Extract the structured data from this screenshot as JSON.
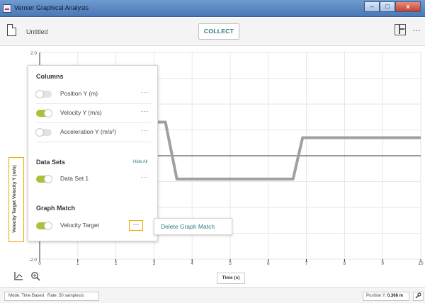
{
  "window": {
    "title": "Vernier Graphical Analysis",
    "minimize": "–",
    "maximize": "□",
    "close": "x"
  },
  "toolbar": {
    "document_name": "Untitled",
    "collect_label": "COLLECT",
    "more_icon": "⋯"
  },
  "graph": {
    "y_axis_label": "Velocity Target  Velocity Y (m/s)",
    "x_axis_label": "Time (s)",
    "y_tick_top": "2.0",
    "y_tick_bottom": "-2.0",
    "x_ticks": [
      "0",
      "1",
      "2",
      "3",
      "4",
      "5",
      "6",
      "7",
      "8",
      "9",
      "10"
    ]
  },
  "chart_data": {
    "type": "line",
    "xlabel": "Time (s)",
    "ylabel": "Velocity Target  Velocity Y (m/s)",
    "xlim": [
      0,
      10
    ],
    "ylim": [
      -2,
      2
    ],
    "series": [
      {
        "name": "Velocity Target",
        "color": "#a0a0a0",
        "x": [
          0,
          3.3,
          3.6,
          6.65,
          6.9,
          10
        ],
        "y": [
          0.65,
          0.65,
          -0.45,
          -0.45,
          0.35,
          0.35
        ]
      }
    ]
  },
  "panel": {
    "columns_title": "Columns",
    "columns": [
      {
        "label": "Position Y (m)",
        "on": false
      },
      {
        "label": "Velocity Y (m/s)",
        "on": true
      },
      {
        "label": "Acceleration Y (m/s²)",
        "on": false
      }
    ],
    "datasets_title": "Data Sets",
    "hide_all": "Hide All",
    "datasets": [
      {
        "label": "Data Set 1",
        "on": true
      }
    ],
    "graph_match_title": "Graph Match",
    "graph_match": [
      {
        "label": "Velocity Target",
        "on": true
      }
    ],
    "dots": "···"
  },
  "context_menu": {
    "delete_label": "Delete Graph Match"
  },
  "status": {
    "mode": "Mode: Time Based",
    "rate": "Rate: 50 samples/s",
    "position_label": "Position Y:",
    "position_value": "0.368 m"
  },
  "colors": {
    "accent": "#2a7c8a",
    "toggle_on": "#a8c23a",
    "highlight": "#f2a900",
    "trace": "#a0a0a0"
  }
}
